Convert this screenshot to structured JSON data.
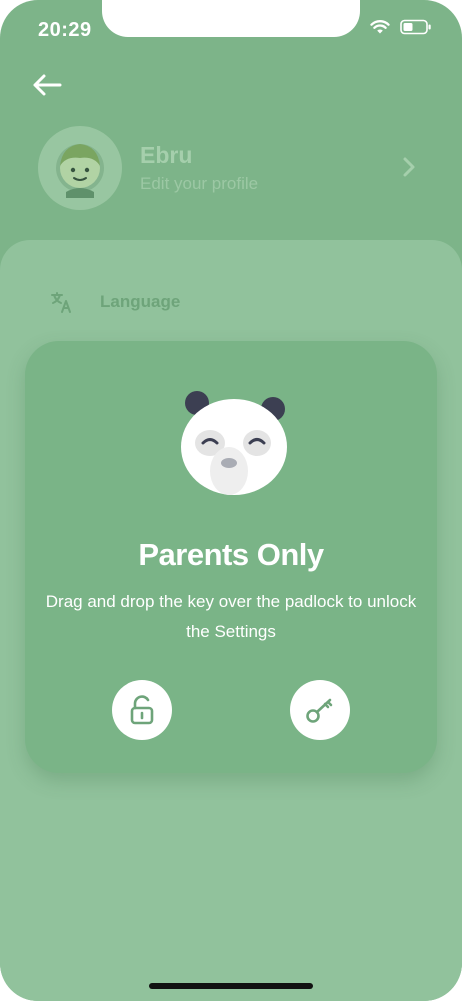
{
  "status_bar": {
    "time": "20:29",
    "icons": [
      "wifi-icon",
      "battery-icon"
    ]
  },
  "header": {
    "back_icon": "arrow-left-icon"
  },
  "profile": {
    "name": "Ebru",
    "subtitle": "Edit your profile",
    "chevron_icon": "chevron-right-icon"
  },
  "settings": {
    "language_label": "Language",
    "language_icon": "translate-icon"
  },
  "parents_card": {
    "title": "Parents Only",
    "description": "Drag and drop the key over the padlock to unlock the Settings",
    "padlock_icon": "padlock-icon",
    "key_icon": "key-icon"
  },
  "colors": {
    "background": "#7db489",
    "sheet": "#91c29c",
    "card": "#7ab487",
    "icon_accent": "#6ea47a"
  }
}
